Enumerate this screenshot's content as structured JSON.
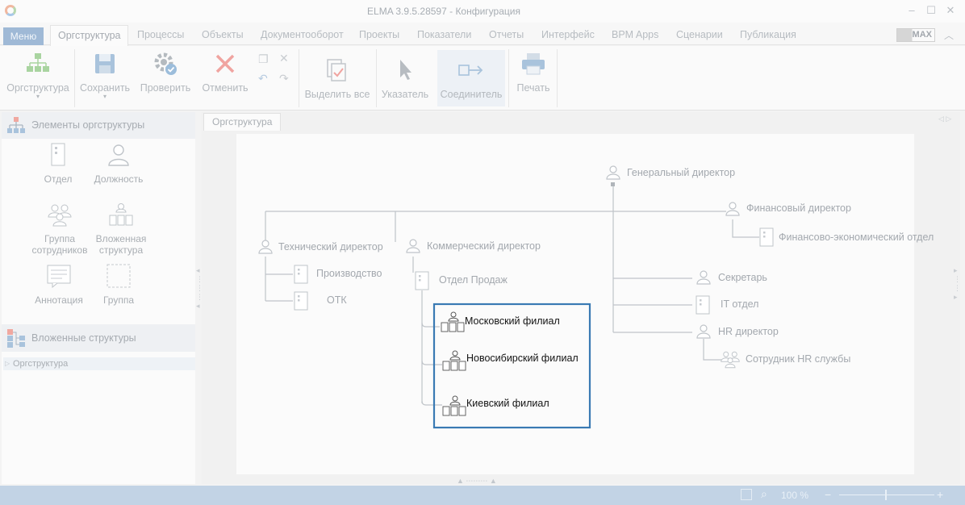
{
  "window": {
    "title": "ELMA 3.9.5.28597 - Конфигурация"
  },
  "menu": {
    "menu_label": "Меню",
    "tabs": [
      "Оргструктура",
      "Процессы",
      "Объекты",
      "Документооборот",
      "Проекты",
      "Показатели",
      "Отчеты",
      "Интерфейс",
      "BPM Apps",
      "Сценарии",
      "Публикация"
    ],
    "max_label": "MAX"
  },
  "ribbon": {
    "orgstructure": "Оргструктура",
    "save": "Сохранить",
    "check": "Проверить",
    "cancel": "Отменить",
    "select_all": "Выделить все",
    "pointer": "Указатель",
    "connector": "Соединитель",
    "print": "Печать"
  },
  "sidebar": {
    "elements_header": "Элементы оргструктуры",
    "palette": [
      {
        "label": "Отдел",
        "icon": "department-icon"
      },
      {
        "label": "Должность",
        "icon": "position-icon"
      },
      {
        "label": "Группа сотрудников",
        "line1": "Группа",
        "line2": "сотрудников",
        "icon": "employee-group-icon"
      },
      {
        "label": "Вложенная структура",
        "line1": "Вложенная",
        "line2": "структура",
        "icon": "nested-structure-icon"
      },
      {
        "label": "Аннотация",
        "icon": "annotation-icon"
      },
      {
        "label": "Группа",
        "icon": "group-icon"
      }
    ],
    "nested_header": "Вложенные структуры",
    "tree_item": "Оргструктура"
  },
  "document": {
    "tab": "Оргструктура"
  },
  "diagram": {
    "general_director": "Генеральный директор",
    "technical_director": "Технический директор",
    "production": "Производство",
    "otk": "ОТК",
    "commercial_director": "Коммерческий директор",
    "sales_department": "Отдел Продаж",
    "moscow_branch": "Московский филиал",
    "novosibirsk_branch": "Новосибирский филиал",
    "kiev_branch": "Киевский филиал",
    "financial_director": "Финансовый директор",
    "finance_department": "Финансово-экономический отдел",
    "secretary": "Секретарь",
    "it_department": "IT отдел",
    "hr_director": "HR директор",
    "hr_employee": "Сотрудник HR службы",
    "highlight_color": "#3a7ab3"
  },
  "status": {
    "zoom": "100 %"
  }
}
